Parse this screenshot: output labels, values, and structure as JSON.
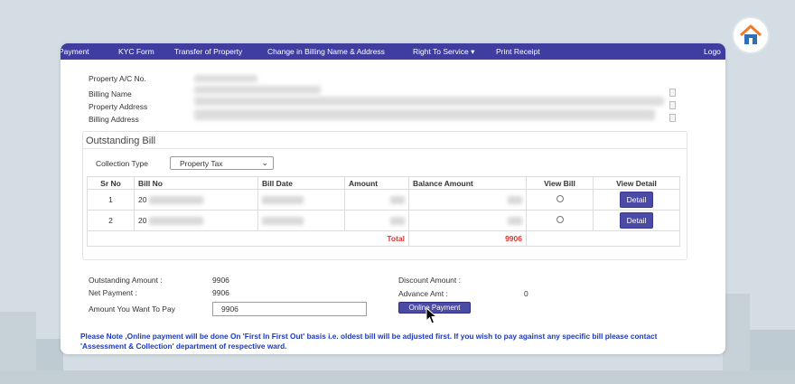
{
  "nav": {
    "items": [
      "Payment",
      "KYC Form",
      "Transfer of Property",
      "Change in Billing Name & Address",
      "Right To Service ▾",
      "Print Receipt",
      "Logo"
    ]
  },
  "property": {
    "labels": [
      "Property A/C No.",
      "Billing Name",
      "Property Address",
      "Billing Address"
    ]
  },
  "outstanding": {
    "title": "Outstanding Bill",
    "collection_type_label": "Collection Type",
    "collection_type_value": "Property Tax",
    "table": {
      "headers": [
        "Sr No",
        "Bill No",
        "Bill Date",
        "Amount",
        "Balance Amount",
        "View Bill",
        "View Detail"
      ],
      "rows": [
        {
          "sr": "1",
          "bill_prefix": "20",
          "action": "Detail"
        },
        {
          "sr": "2",
          "bill_prefix": "20",
          "action": "Detail"
        }
      ],
      "total_label": "Total",
      "total_value": "9906"
    }
  },
  "summary": {
    "outstanding_label": "Outstanding Amount :",
    "outstanding_value": "9906",
    "net_label": "Net Payment :",
    "net_value": "9906",
    "amount_label": "Amount You Want To Pay",
    "amount_value": "9906",
    "discount_label": "Discount Amount :",
    "advance_label": "Advance Amt :",
    "advance_value": "0",
    "pay_button": "Online Payment"
  },
  "note": "Please Note ,Online payment will be done On 'First In First Out' basis i.e. oldest bill will be adjusted first. If you wish to pay against any specific bill please contact 'Assessment & Collection' department of respective ward.",
  "colors": {
    "nav": "#3f3d9f",
    "button": "#4b4aa6",
    "value_red": "#e3342f",
    "note_blue": "#1a39c4",
    "background": "#d3dde3"
  }
}
